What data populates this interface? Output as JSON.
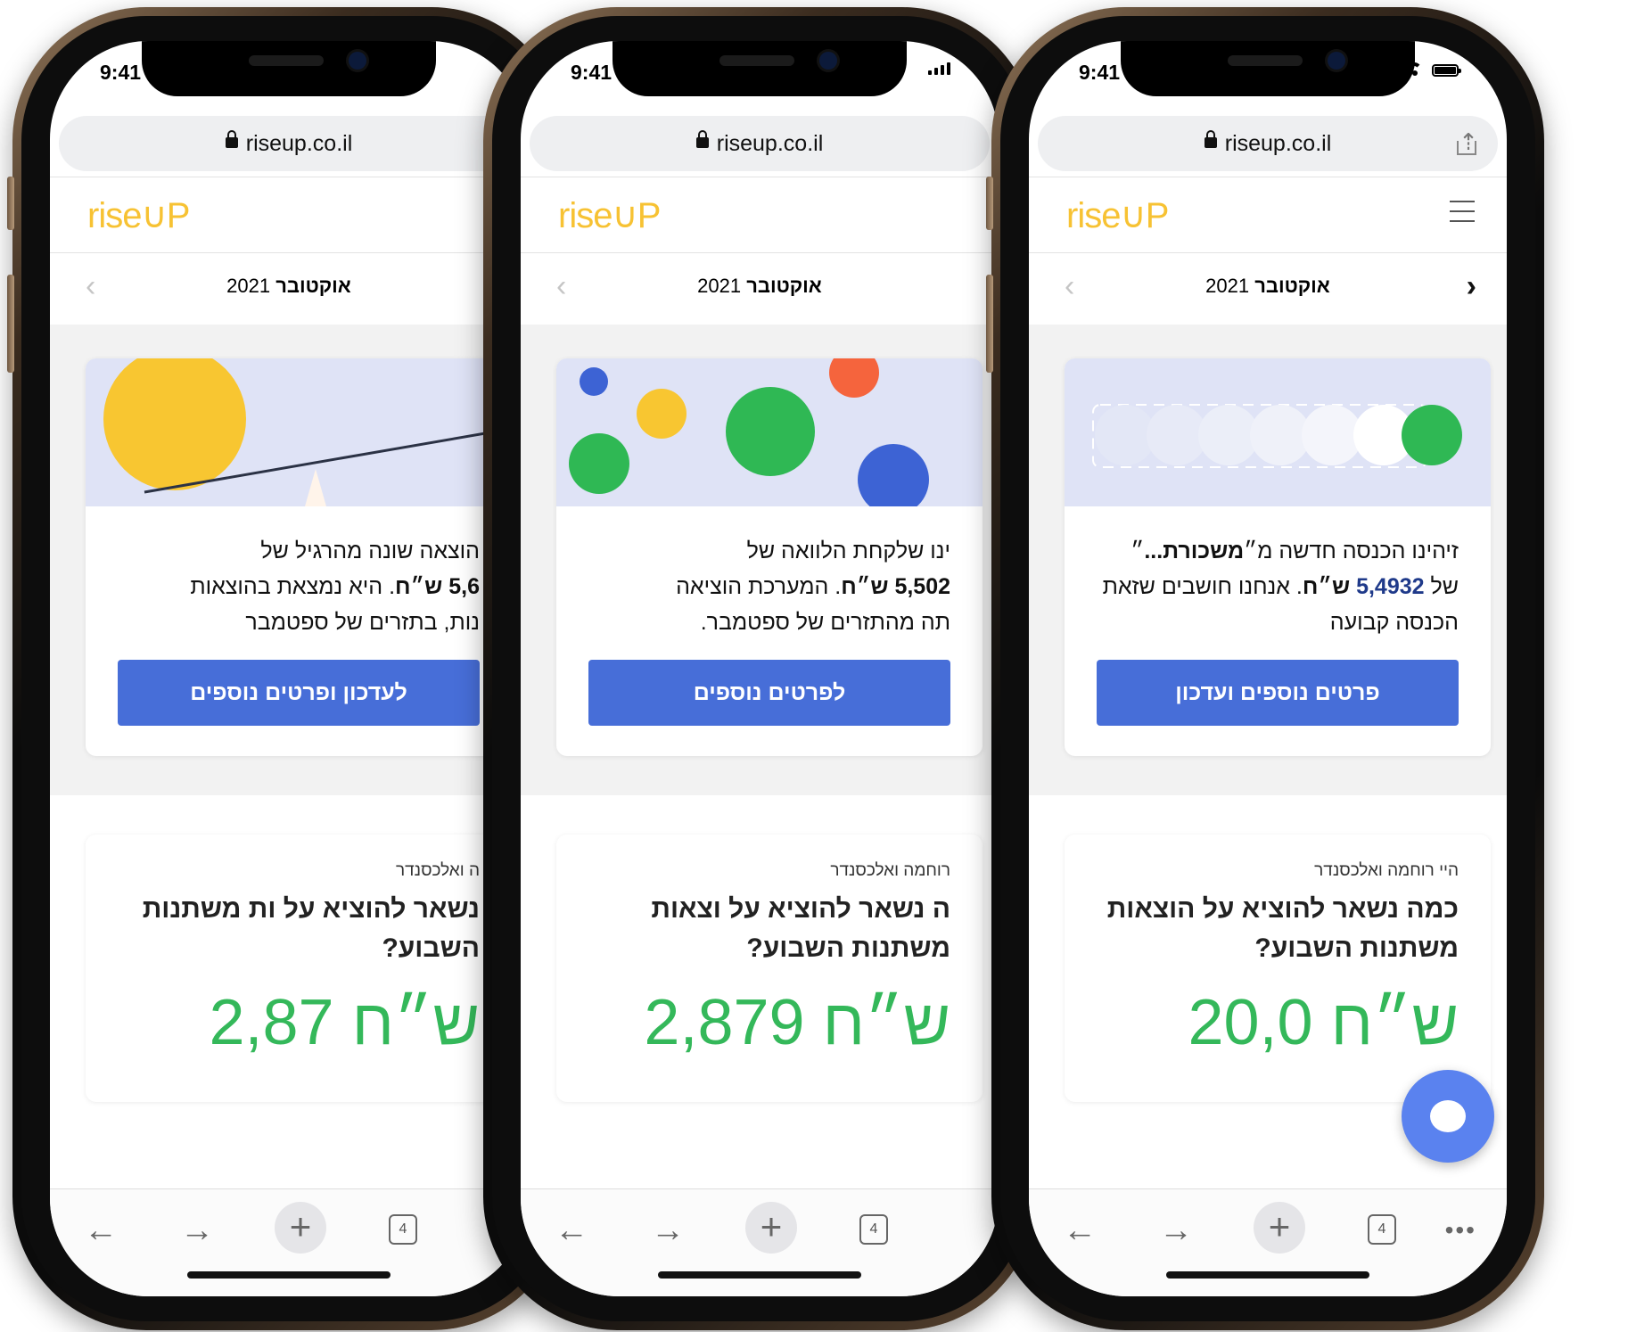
{
  "status": {
    "time": "9:41"
  },
  "browser": {
    "url": "riseup.co.il",
    "tab_count": "4"
  },
  "header": {
    "logo_text": "riseUP",
    "month_name": "אוקטובר",
    "year": "2021"
  },
  "phones": [
    {
      "card_text_a": "הוצאה שונה מהרגיל של",
      "card_amount": "5,6",
      "card_text_b": ". היא נמצאת בהוצאות",
      "card_text_c": "נות, בתזרים של ספטמבר",
      "card_button": "לעדכון ופרטים נוספים",
      "greeting": "ה ואלכסנדר",
      "question": "נשאר להוציא על ות משתנות השבוע?",
      "amount": "2,87"
    },
    {
      "card_text_a": "ינו שלקחת הלוואה של",
      "card_amount": "5,502",
      "card_text_b": ". המערכת הוציאה",
      "card_text_c": "תה מהתזרים של ספטמבר.",
      "card_button": "לפרטים נוספים",
      "greeting": "רוחמה ואלכסנדר",
      "question": "ה נשאר להוציא על וצאות משתנות השבוע?",
      "amount": "2,879"
    },
    {
      "card_text_a": "זיהינו הכנסה חדשה מ״",
      "card_source": "משכורת...",
      "card_text_a2": "״",
      "card_text_pre": "של",
      "card_amount": "5,4932",
      "card_text_b": ". אנחנו חושבים שזאת",
      "card_text_c": "הכנסה קבועה",
      "card_button": "פרטים נוספים ועדכון",
      "greeting": "היי רוחמה ואלכסנדר",
      "question": "כמה נשאר להוציא על הוצאות משתנות השבוע?",
      "amount": "20,0"
    }
  ],
  "currency": "ש״ח",
  "colors": {
    "brand_yellow": "#f7c233",
    "button_blue": "#476ed8",
    "amount_green": "#34b85a",
    "illus_bg": "#dfe3f6"
  }
}
